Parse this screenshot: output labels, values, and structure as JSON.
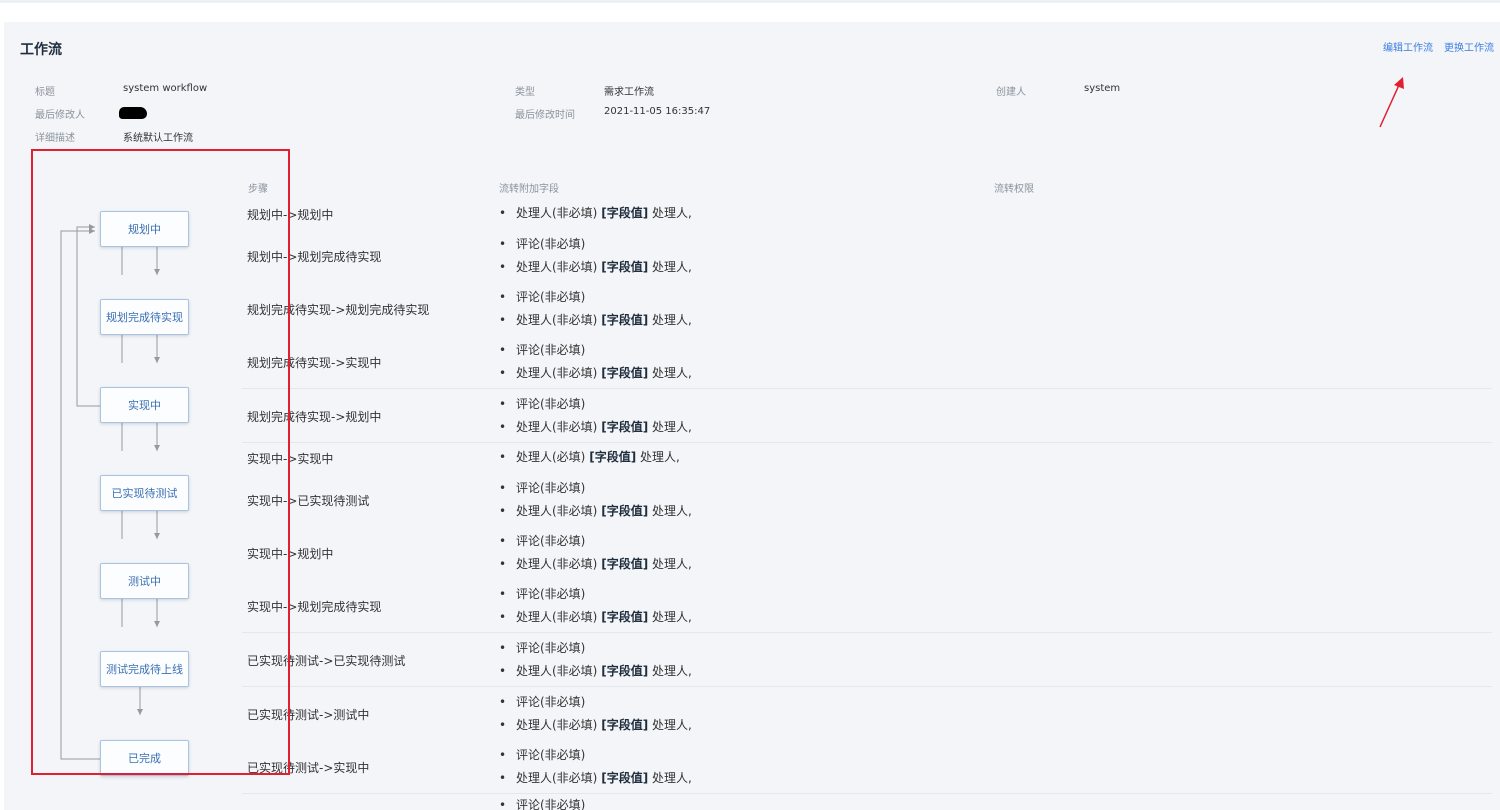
{
  "workflow": {
    "title": "工作流",
    "actions": {
      "edit": "编辑工作流",
      "replace": "更换工作流"
    },
    "meta": {
      "title_label": "标题",
      "title_value": "system workflow",
      "type_label": "类型",
      "type_value": "需求工作流",
      "creator_label": "创建人",
      "creator_value": "system",
      "modifier_label": "最后修改人",
      "modified_time_label": "最后修改时间",
      "modified_time_value": "2021-11-05 16:35:47",
      "desc_label": "详细描述",
      "desc_value": "系统默认工作流"
    }
  },
  "diagram": {
    "nodes": [
      {
        "label": "规划中"
      },
      {
        "label": "规划完成待实现"
      },
      {
        "label": "实现中"
      },
      {
        "label": "已实现待测试"
      },
      {
        "label": "测试中"
      },
      {
        "label": "测试完成待上线"
      },
      {
        "label": "已完成"
      }
    ]
  },
  "table": {
    "headers": {
      "step": "步骤",
      "fields": "流转附加字段",
      "permission": "流转权限"
    },
    "rows": [
      {
        "step": "规划中->规划中",
        "items": [
          {
            "text": "处理人(非必填)",
            "tag": "[字段值]",
            "value": "处理人,"
          }
        ]
      },
      {
        "step": "规划中->规划完成待实现",
        "items": [
          {
            "text": "评论(非必填)"
          },
          {
            "text": "处理人(非必填)",
            "tag": "[字段值]",
            "value": "处理人,"
          }
        ]
      },
      {
        "step": "规划完成待实现->规划完成待实现",
        "items": [
          {
            "text": "评论(非必填)"
          },
          {
            "text": "处理人(非必填)",
            "tag": "[字段值]",
            "value": "处理人,"
          }
        ]
      },
      {
        "step": "规划完成待实现->实现中",
        "items": [
          {
            "text": "评论(非必填)"
          },
          {
            "text": "处理人(非必填)",
            "tag": "[字段值]",
            "value": "处理人,"
          }
        ]
      },
      {
        "step": "规划完成待实现->规划中",
        "items": [
          {
            "text": "评论(非必填)"
          },
          {
            "text": "处理人(非必填)",
            "tag": "[字段值]",
            "value": "处理人,"
          }
        ]
      },
      {
        "step": "实现中->实现中",
        "items": [
          {
            "text": "处理人(必填)",
            "tag": "[字段值]",
            "value": "处理人,"
          }
        ]
      },
      {
        "step": "实现中->已实现待测试",
        "items": [
          {
            "text": "评论(非必填)"
          },
          {
            "text": "处理人(非必填)",
            "tag": "[字段值]",
            "value": "处理人,"
          }
        ]
      },
      {
        "step": "实现中->规划中",
        "items": [
          {
            "text": "评论(非必填)"
          },
          {
            "text": "处理人(非必填)",
            "tag": "[字段值]",
            "value": "处理人,"
          }
        ]
      },
      {
        "step": "实现中->规划完成待实现",
        "items": [
          {
            "text": "评论(非必填)"
          },
          {
            "text": "处理人(非必填)",
            "tag": "[字段值]",
            "value": "处理人,"
          }
        ]
      },
      {
        "step": "已实现待测试->已实现待测试",
        "items": [
          {
            "text": "评论(非必填)"
          },
          {
            "text": "处理人(非必填)",
            "tag": "[字段值]",
            "value": "处理人,"
          }
        ]
      },
      {
        "step": "已实现待测试->测试中",
        "items": [
          {
            "text": "评论(非必填)"
          },
          {
            "text": "处理人(非必填)",
            "tag": "[字段值]",
            "value": "处理人,"
          }
        ]
      },
      {
        "step": "已实现待测试->实现中",
        "items": [
          {
            "text": "评论(非必填)"
          },
          {
            "text": "处理人(非必填)",
            "tag": "[字段值]",
            "value": "处理人,"
          }
        ]
      },
      {
        "step": "",
        "items": [
          {
            "text": "评论(非必填)"
          }
        ]
      }
    ]
  }
}
